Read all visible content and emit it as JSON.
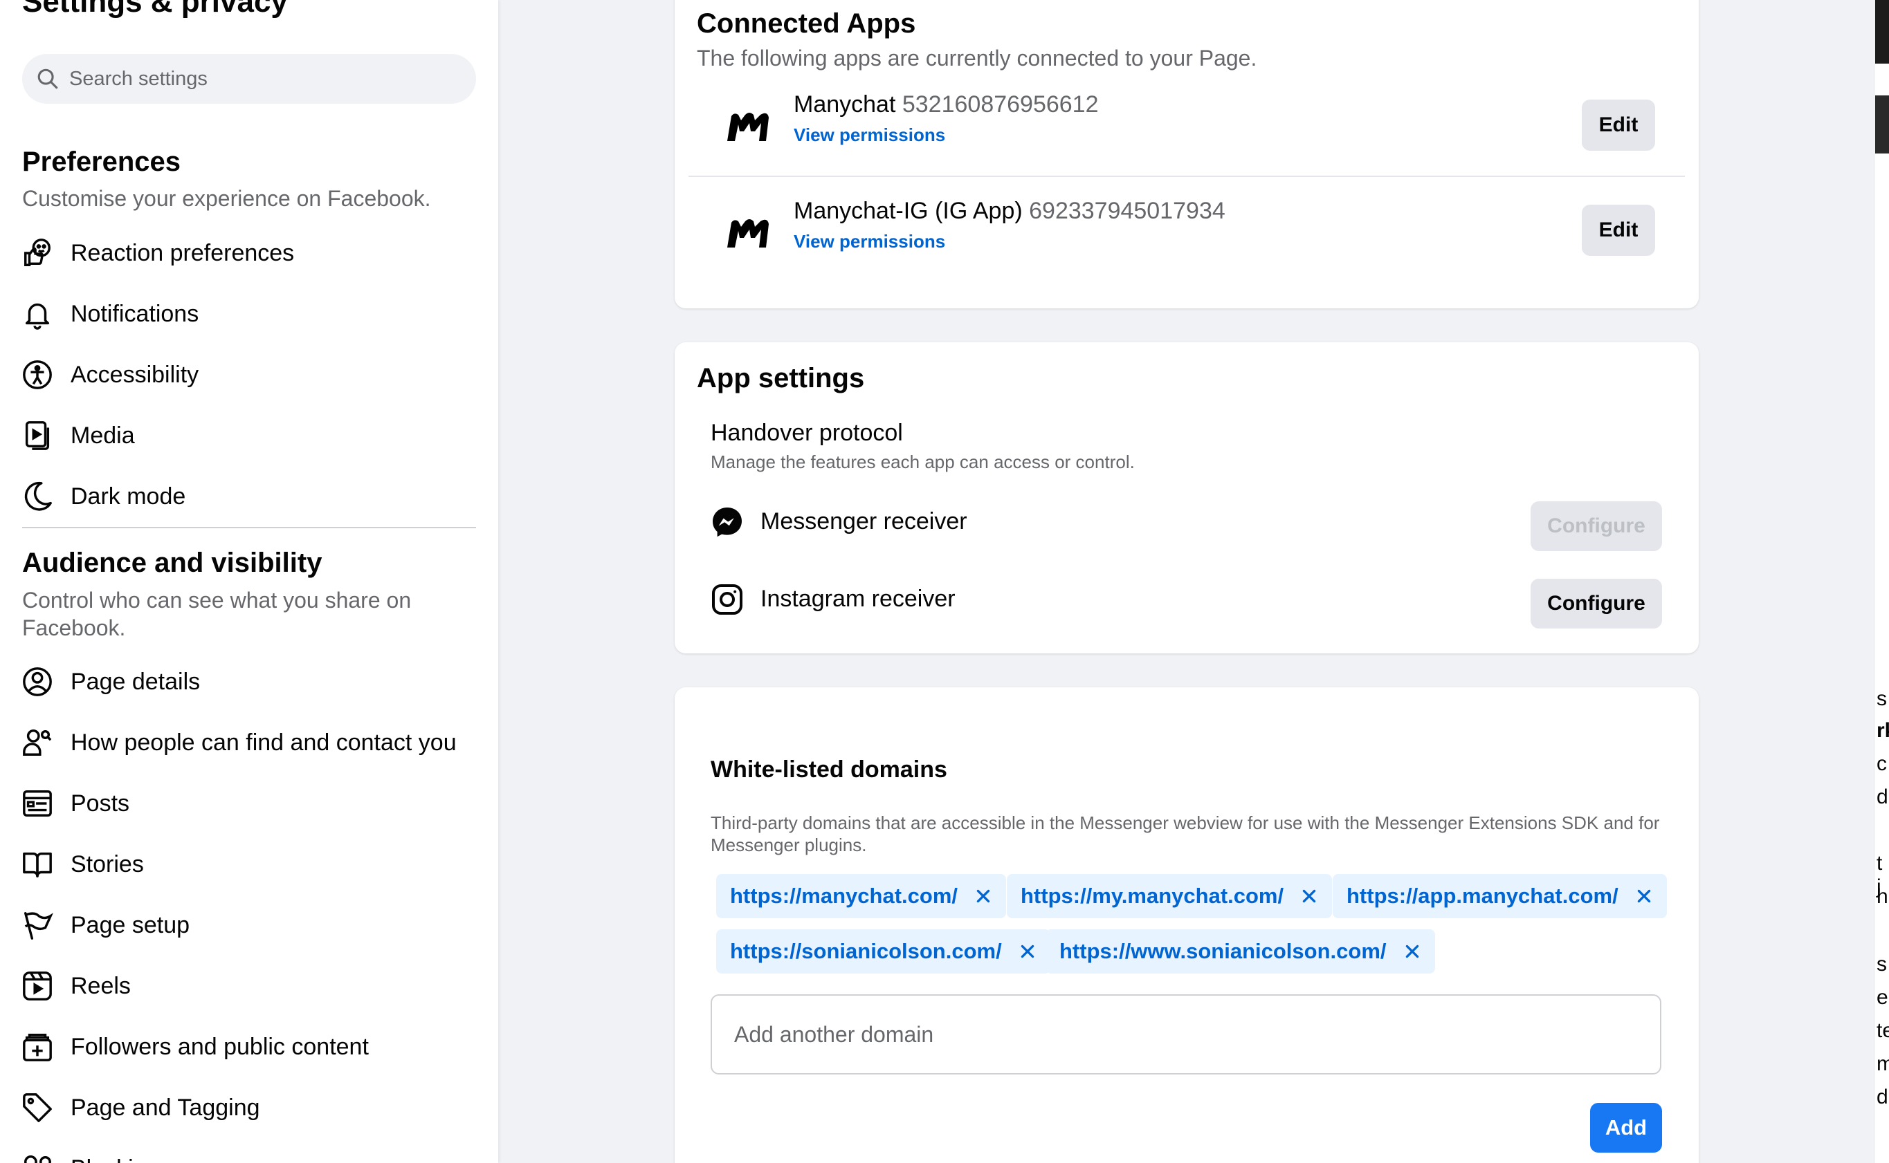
{
  "sidebar": {
    "title": "Settings & privacy",
    "search_placeholder": "Search settings",
    "preferences": {
      "heading": "Preferences",
      "subtitle": "Customise your experience on Facebook.",
      "items": [
        {
          "label": "Reaction preferences",
          "icon": "reaction-icon"
        },
        {
          "label": "Notifications",
          "icon": "bell-icon"
        },
        {
          "label": "Accessibility",
          "icon": "accessibility-icon"
        },
        {
          "label": "Media",
          "icon": "media-icon"
        },
        {
          "label": "Dark mode",
          "icon": "moon-icon"
        }
      ]
    },
    "audience": {
      "heading": "Audience and visibility",
      "subtitle": "Control who can see what you share on Facebook.",
      "items": [
        {
          "label": "Page details",
          "icon": "person-circle-icon"
        },
        {
          "label": "How people can find and contact you",
          "icon": "person-search-icon"
        },
        {
          "label": "Posts",
          "icon": "posts-icon"
        },
        {
          "label": "Stories",
          "icon": "book-icon"
        },
        {
          "label": "Page setup",
          "icon": "flag-icon"
        },
        {
          "label": "Reels",
          "icon": "reels-icon"
        },
        {
          "label": "Followers and public content",
          "icon": "followers-icon"
        },
        {
          "label": "Page and Tagging",
          "icon": "tag-icon"
        },
        {
          "label": "Blocking",
          "icon": "blocking-icon"
        }
      ]
    }
  },
  "connected_apps": {
    "title": "Connected Apps",
    "subtitle": "The following apps are currently connected to your Page.",
    "apps": [
      {
        "name": "Manychat",
        "id": "532160876956612",
        "permissions_label": "View permissions",
        "edit_label": "Edit"
      },
      {
        "name": "Manychat-IG (IG App)",
        "id": "692337945017934",
        "permissions_label": "View permissions",
        "edit_label": "Edit"
      }
    ]
  },
  "app_settings": {
    "title": "App settings",
    "handover_title": "Handover protocol",
    "handover_subtitle": "Manage the features each app can access or control.",
    "receivers": [
      {
        "label": "Messenger receiver",
        "icon": "messenger-icon",
        "button": "Configure",
        "disabled": true
      },
      {
        "label": "Instagram receiver",
        "icon": "instagram-icon",
        "button": "Configure",
        "disabled": false
      }
    ]
  },
  "whitelisted": {
    "title": "White-listed domains",
    "description": "Third-party domains that are accessible in the Messenger webview for use with the Messenger Extensions SDK and for Messenger plugins.",
    "domains": [
      "https://manychat.com/",
      "https://my.manychat.com/",
      "https://app.manychat.com/",
      "https://sonianicolson.com/",
      "https://www.sonianicolson.com/"
    ],
    "input_placeholder": "Add another domain",
    "add_label": "Add"
  },
  "right_edge_chars": [
    "s",
    "rk",
    "c",
    "d",
    "t j",
    "h",
    "s",
    "e",
    "te",
    "m",
    "d"
  ],
  "colors": {
    "accent": "#1877f2",
    "link": "#0064d1",
    "chip_bg": "#e7f3ff",
    "page_bg": "#f0f2f5"
  }
}
